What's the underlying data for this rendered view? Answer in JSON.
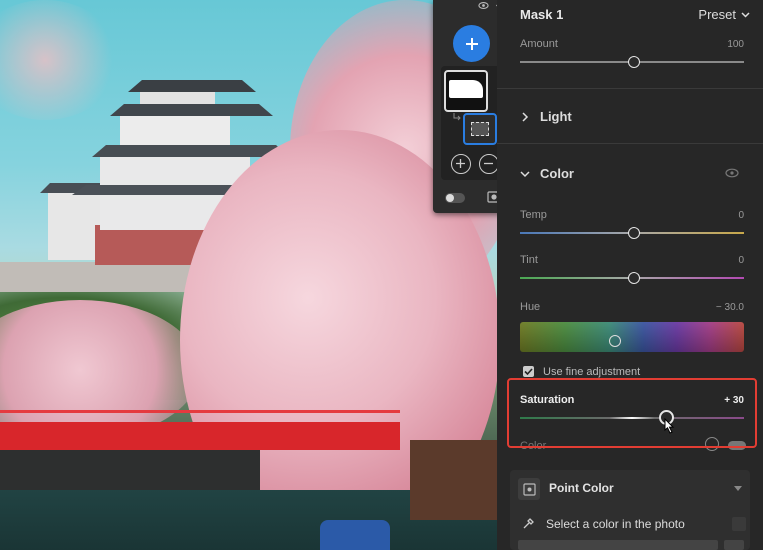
{
  "mask_panel": {
    "add_label": "+",
    "add_color": "#2a7de1"
  },
  "panel": {
    "title": "Mask 1",
    "preset_label": "Preset",
    "amount": {
      "label": "Amount",
      "value": "100",
      "level": 0.5
    },
    "light_section": "Light",
    "color_section": "Color",
    "temp": {
      "label": "Temp",
      "value": "0",
      "level": 0.5
    },
    "tint": {
      "label": "Tint",
      "value": "0",
      "level": 0.5
    },
    "hue": {
      "label": "Hue",
      "value": "− 30.0",
      "level": 0.42
    },
    "fine_adjustment": "Use fine adjustment",
    "saturation": {
      "label": "Saturation",
      "value": "+ 30",
      "level": 0.65
    },
    "color_row": "Color",
    "point_color": {
      "title": "Point Color",
      "select_text": "Select a color in the photo"
    },
    "highlight_color": "#e23d33"
  }
}
